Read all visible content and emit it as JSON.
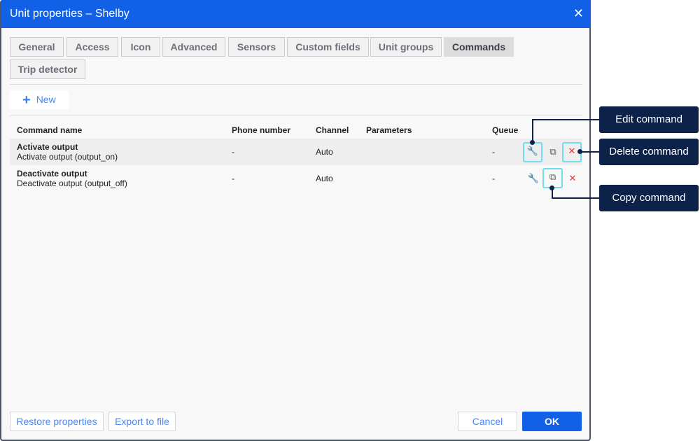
{
  "window": {
    "title": "Unit properties – Shelby",
    "close": "✕"
  },
  "tabs": [
    "General",
    "Access",
    "Icon",
    "Advanced",
    "Sensors",
    "Custom fields",
    "Unit groups",
    "Commands",
    "Trip detector"
  ],
  "active_tab": "Commands",
  "toolbar": {
    "new_icon": "+",
    "new_label": "New"
  },
  "table": {
    "headers": [
      "Command name",
      "Phone number",
      "Channel",
      "Parameters",
      "Queue"
    ],
    "rows": [
      {
        "name": "Activate output",
        "subtitle": "Activate output (output_on)",
        "phone": "-",
        "channel": "Auto",
        "parameters": "",
        "queue": "-"
      },
      {
        "name": "Deactivate output",
        "subtitle": "Deactivate output (output_off)",
        "phone": "-",
        "channel": "Auto",
        "parameters": "",
        "queue": "-"
      }
    ],
    "icons": {
      "edit": "wrench-icon",
      "copy": "copy-icon",
      "delete": "delete-icon"
    }
  },
  "footer": {
    "restore": "Restore properties",
    "export": "Export to file",
    "cancel": "Cancel",
    "ok": "OK"
  },
  "callouts": {
    "edit": "Edit command",
    "delete": "Delete command",
    "copy": "Copy command"
  },
  "colors": {
    "header": "#1160e6",
    "callout": "#0c2249",
    "highlight": "#6fdcf0",
    "delete": "#e53935"
  }
}
